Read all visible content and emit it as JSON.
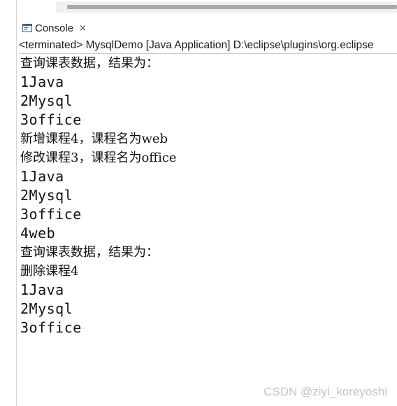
{
  "tab": {
    "label": "Console",
    "close_glyph": "×",
    "icon": "console-icon"
  },
  "status": {
    "text": "<terminated> MysqlDemo [Java Application] D:\\eclipse\\plugins\\org.eclipse"
  },
  "output_lines": [
    "查询课表数据，结果为：",
    "1Java",
    "2Mysql",
    "3office",
    "新增课程4，课程名为web",
    "修改课程3，课程名为office",
    "1Java",
    "2Mysql",
    "3office",
    "4web",
    "查询课表数据，结果为：",
    "删除课程4",
    "1Java",
    "2Mysql",
    "3office"
  ],
  "watermark": "CSDN @ziyi_koreyoshi"
}
